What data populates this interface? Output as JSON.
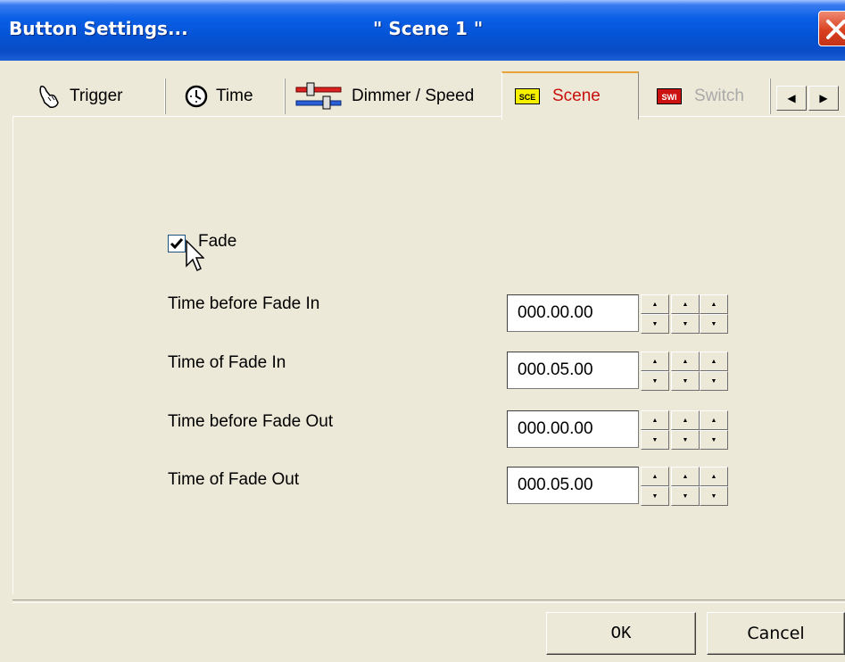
{
  "window": {
    "title": "Button Settings...",
    "subtitle": "\" Scene 1 \""
  },
  "tabs": [
    {
      "label": "Trigger",
      "icon": "hand-pointer-icon",
      "state": "normal"
    },
    {
      "label": "Time",
      "icon": "clock-icon",
      "state": "normal"
    },
    {
      "label": "Dimmer / Speed",
      "icon": "sliders-icon",
      "state": "normal"
    },
    {
      "label": "Scene",
      "icon": "scene-icon",
      "icon_text": "SCE",
      "state": "active"
    },
    {
      "label": "Switch",
      "icon": "switch-icon",
      "icon_text": "SWI",
      "state": "disabled"
    }
  ],
  "tab_scroll": {
    "left_icon": "arrow-left-icon",
    "right_icon": "arrow-right-icon"
  },
  "fade": {
    "label": "Fade",
    "checked": true
  },
  "rows": [
    {
      "label": "Time before Fade In",
      "value": "000.00.00"
    },
    {
      "label": "Time of Fade In",
      "value": "000.05.00"
    },
    {
      "label": "Time before Fade Out",
      "value": "000.00.00"
    },
    {
      "label": "Time of Fade Out",
      "value": "000.05.00"
    }
  ],
  "buttons": {
    "ok": "OK",
    "cancel": "Cancel"
  },
  "colors": {
    "titlebar": "#0553d4",
    "window_bg": "#ECE9D8",
    "active_tab_text": "#c8100c",
    "disabled_tab_text": "#a9a9a9",
    "scene_icon_bg": "#f5f000",
    "switch_icon_bg": "#cc1111",
    "close_button": "#d9411f"
  }
}
